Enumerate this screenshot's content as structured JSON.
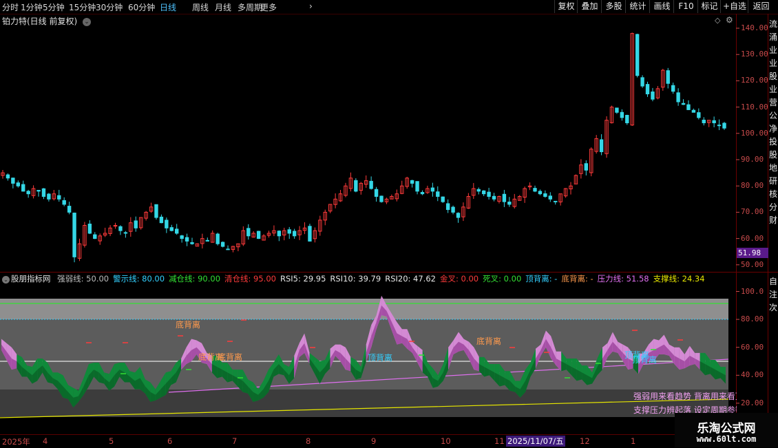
{
  "topbar": {
    "periods": [
      "分时",
      "1分钟",
      "5分钟",
      "15分钟",
      "30分钟",
      "60分钟",
      "日线",
      "周线",
      "月线",
      "多周期",
      "更多"
    ],
    "more_chevron": "›",
    "active_period": "日线",
    "buttons": [
      "复权",
      "叠加",
      "多股",
      "统计",
      "画线",
      "F10",
      "标记",
      "+自选",
      "返回"
    ]
  },
  "stock": {
    "title": "铂力特(日线 前复权)",
    "icons": [
      "diamond-icon",
      "gear-icon"
    ]
  },
  "price_axis": {
    "labels": [
      "140.00",
      "130.00",
      "120.00",
      "110.00",
      "100.00",
      "90.00",
      "80.00",
      "70.00",
      "60.00",
      "50.00"
    ],
    "current": "51.98"
  },
  "price_chart": {
    "type": "candlestick",
    "closes": [
      85,
      83,
      81,
      80,
      78,
      77,
      79,
      78,
      76,
      75,
      77,
      75,
      73,
      70,
      53,
      58,
      65,
      62,
      60,
      61,
      62,
      64,
      65,
      63,
      62,
      66,
      64,
      68,
      70,
      72,
      68,
      66,
      64,
      63,
      62,
      60,
      59,
      58,
      58,
      60,
      59,
      62,
      58,
      57,
      56,
      57,
      58,
      63,
      61,
      62,
      60,
      61,
      62,
      63,
      61,
      63,
      62,
      61,
      63,
      64,
      59,
      63,
      67,
      70,
      73,
      75,
      77,
      80,
      83,
      78,
      81,
      82,
      79,
      76,
      74,
      75,
      76,
      77,
      80,
      83,
      81,
      78,
      77,
      79,
      78,
      76,
      74,
      71,
      70,
      68,
      72,
      76,
      79,
      78,
      77,
      76,
      75,
      76,
      74,
      73,
      75,
      76,
      79,
      80,
      78,
      77,
      76,
      75,
      74,
      77,
      79,
      80,
      84,
      88,
      86,
      94,
      98,
      93,
      105,
      110,
      108,
      106,
      104,
      138,
      122,
      118,
      115,
      113,
      117,
      124,
      119,
      116,
      112,
      111,
      109,
      108,
      106,
      104,
      105,
      104,
      103,
      102
    ],
    "colors": {
      "up": "#ff3b3b",
      "down": "#34d7e6"
    }
  },
  "indicator": {
    "name": "股朋指标网",
    "params": [
      {
        "label": "强弱线: 50.00",
        "color": "#bdbdbd"
      },
      {
        "label": "警示线: 80.00",
        "color": "#33d0ff"
      },
      {
        "label": "减仓线: 90.00",
        "color": "#33e033"
      },
      {
        "label": "清仓线: 95.00",
        "color": "#ff3b3b"
      },
      {
        "label": "RSI5: 29.95",
        "color": "#e8e8e8"
      },
      {
        "label": "RSI10: 39.79",
        "color": "#e8e8e8"
      },
      {
        "label": "RSI20: 47.62",
        "color": "#e8e8e8"
      },
      {
        "label": "金叉: 0.00",
        "color": "#ff3b3b"
      },
      {
        "label": "死叉: 0.00",
        "color": "#33e033"
      },
      {
        "label": "顶背离: -",
        "color": "#33d0ff"
      },
      {
        "label": "底背离: -",
        "color": "#ff9a4d"
      },
      {
        "label": "压力线: 51.58",
        "color": "#e070f0"
      },
      {
        "label": "支撑线: 24.34",
        "color": "#e6e600"
      }
    ],
    "axis": [
      "100.0",
      "80.00",
      "60.00",
      "40.00",
      "20.00"
    ],
    "levels": {
      "strong_weak": 50,
      "warning": 80,
      "reduce": 90,
      "clear": 95
    },
    "notes": [
      "强弱用来看趋势 背离用来看顶",
      "支撑压力辨起落 设定周期参数"
    ],
    "signals": [
      {
        "text": "底背离",
        "kind": "bottom"
      },
      {
        "text": "底背离",
        "kind": "bottom"
      },
      {
        "text": "底背离",
        "kind": "bottom"
      },
      {
        "text": "顶背离",
        "kind": "top"
      },
      {
        "text": "底背离",
        "kind": "bottom"
      },
      {
        "text": "顶背离",
        "kind": "top"
      },
      {
        "text": "顶背离",
        "kind": "top"
      }
    ],
    "rsi_series": [
      62,
      57,
      52,
      50,
      46,
      43,
      40,
      44,
      47,
      42,
      38,
      36,
      32,
      28,
      24,
      25,
      32,
      40,
      44,
      42,
      38,
      35,
      40,
      44,
      42,
      39,
      36,
      38,
      32,
      28,
      26,
      30,
      34,
      38,
      42,
      48,
      54,
      58,
      60,
      56,
      52,
      48,
      46,
      44,
      42,
      40,
      38,
      36,
      32,
      28,
      26,
      30,
      36,
      44,
      48,
      44,
      40,
      46,
      58,
      63,
      52,
      47,
      42,
      46,
      52,
      58,
      56,
      52,
      48,
      44,
      42,
      56,
      68,
      78,
      90,
      86,
      78,
      70,
      68,
      66,
      60,
      55,
      50,
      44,
      38,
      36,
      42,
      52,
      60,
      64,
      62,
      58,
      52,
      48,
      46,
      44,
      42,
      40,
      38,
      36,
      32,
      30,
      36,
      44,
      52,
      58,
      66,
      60,
      52,
      50,
      48,
      46,
      44,
      42,
      40,
      38,
      46,
      52,
      58,
      64,
      60,
      56,
      52,
      50,
      48,
      52,
      56,
      58,
      60,
      62,
      58,
      54,
      52,
      50,
      54,
      52,
      50,
      48,
      46,
      44,
      42,
      40
    ]
  },
  "right_vertical_text": {
    "top": "流涌业业股业营公净投股地研核分财",
    "bottom": "自注次"
  },
  "date_axis": {
    "labels": [
      "2025年",
      "4",
      "5",
      "6",
      "7",
      "8",
      "9",
      "10",
      "11",
      "12",
      "1"
    ],
    "highlight": "2025/11/07/五"
  },
  "watermark": {
    "site": "乐淘公式网",
    "url": "www.60lt.com"
  }
}
